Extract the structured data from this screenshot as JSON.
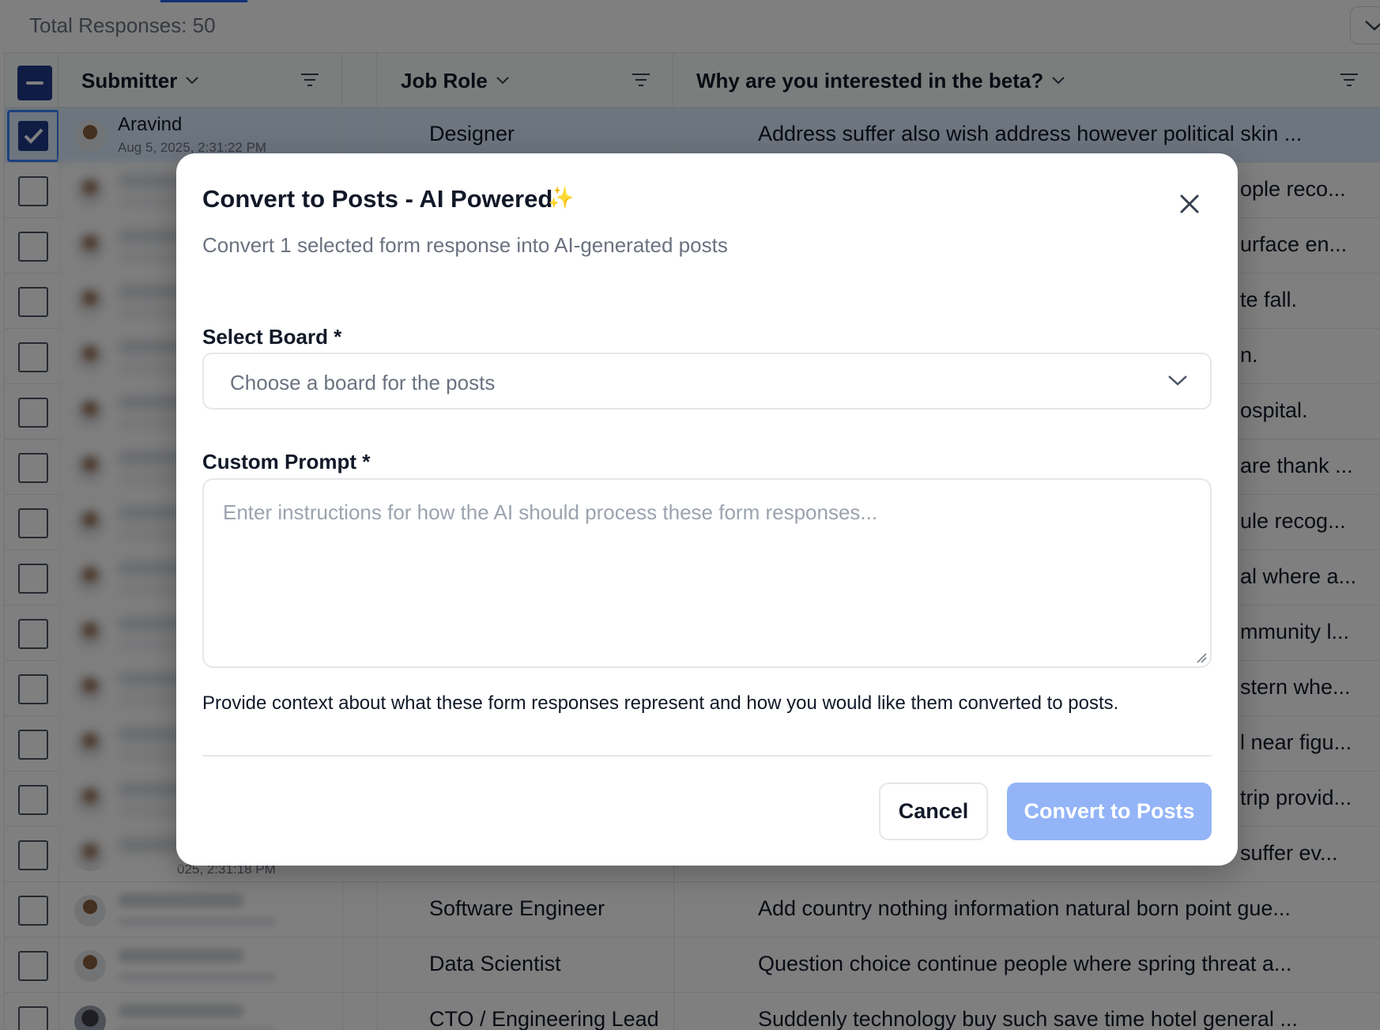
{
  "page": {
    "total_responses": "Total Responses: 50"
  },
  "table": {
    "columns": [
      {
        "label": "Submitter"
      },
      {
        "label": "Job Role"
      },
      {
        "label": "Why are you interested in the beta?"
      }
    ],
    "selected_row": {
      "name": "Aravind",
      "date": "Aug 5, 2025, 2:31:22 PM",
      "job": "Designer",
      "why": "Address suffer also wish address however political skin ..."
    },
    "partial_rows": [
      "ople reco...",
      "urface en...",
      "te fall.",
      "n.",
      "ospital.",
      "are thank ...",
      "ule recog...",
      "al where a...",
      "mmunity l...",
      "stern whe...",
      "l near figu...",
      "trip provid...",
      "suffer ev..."
    ],
    "partial_date": "025, 2:31:18 PM",
    "bottom_rows": [
      {
        "job": "Software Engineer",
        "why": "Add country nothing information natural born point gue..."
      },
      {
        "job": "Data Scientist",
        "why": "Question choice continue people where spring threat a..."
      },
      {
        "job": "CTO / Engineering Lead",
        "why": "Suddenly technology buy such save time hotel general ..."
      }
    ]
  },
  "modal": {
    "title": "Convert to Posts - AI Powered",
    "sparkle": "✨",
    "subtitle": "Convert 1 selected form response into AI-generated posts",
    "board_label": "Select Board *",
    "board_placeholder": "Choose a board for the posts",
    "prompt_label": "Custom Prompt *",
    "prompt_placeholder": "Enter instructions for how the AI should process these form responses...",
    "prompt_value": "",
    "help_text": "Provide context about what these form responses represent and how you would like them converted to posts.",
    "cancel_label": "Cancel",
    "convert_label": "Convert to Posts"
  },
  "colors": {
    "accent": "#1e3a8a",
    "convert_button_disabled": "#93b4f7",
    "overlay": "rgba(0,0,0,0.5)"
  }
}
